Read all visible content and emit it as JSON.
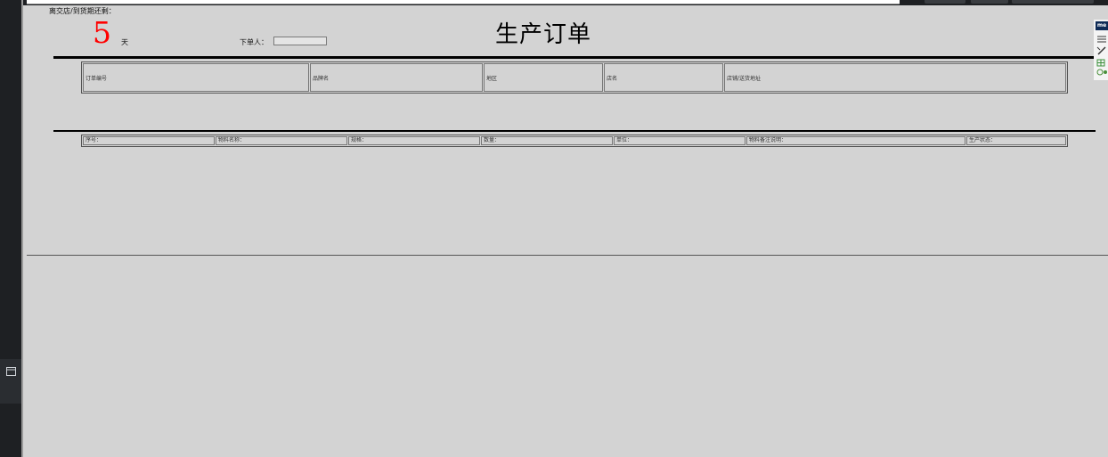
{
  "browser": {
    "menu_icon": "hamburger-icon",
    "pen_icon": "pen-icon",
    "panel_icon": "panel-toggle-icon",
    "extension_logo": "me"
  },
  "form": {
    "deadline_label": "离交店/到货期还剩：",
    "days_remaining": "5",
    "days_unit": "天",
    "orderer_label": "下单人：",
    "orderer_value": ""
  },
  "title": "生产订单",
  "header_fields": [
    {
      "label": "订单编号"
    },
    {
      "label": "品牌名"
    },
    {
      "label": "地区"
    },
    {
      "label": "店名"
    },
    {
      "label": "店铺/送货地址"
    }
  ],
  "item_columns": [
    "序号：",
    "物料名称：",
    "规格：",
    "数量：",
    "单位：",
    "物料备注说明：",
    "生产状态："
  ],
  "colors": {
    "days_color": "#ff0000",
    "page_bg": "#d3d3d3"
  }
}
